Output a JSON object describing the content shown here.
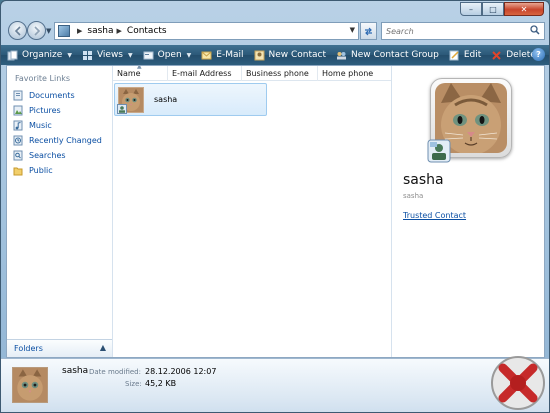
{
  "window": {
    "caption": {
      "min": "–",
      "max": "□",
      "close": "✕"
    }
  },
  "address_bar": {
    "crumbs": [
      "sasha",
      "Contacts"
    ],
    "search_placeholder": "Search"
  },
  "toolbar": {
    "items": [
      {
        "label": "Organize",
        "icon": "organize-icon",
        "dropdown": true
      },
      {
        "label": "Views",
        "icon": "views-icon",
        "dropdown": true
      },
      {
        "label": "Open",
        "icon": "open-icon",
        "dropdown": true
      },
      {
        "label": "E-Mail",
        "icon": "email-icon",
        "dropdown": false
      },
      {
        "label": "New Contact",
        "icon": "new-contact-icon",
        "dropdown": false
      },
      {
        "label": "New Contact Group",
        "icon": "new-contact-group-icon",
        "dropdown": false
      },
      {
        "label": "Edit",
        "icon": "edit-icon",
        "dropdown": false
      },
      {
        "label": "Delete",
        "icon": "delete-icon",
        "dropdown": false
      }
    ],
    "more": "»",
    "help": "?"
  },
  "nav_pane": {
    "title": "Favorite Links",
    "links": [
      {
        "label": "Documents",
        "icon": "documents-icon"
      },
      {
        "label": "Pictures",
        "icon": "pictures-icon"
      },
      {
        "label": "Music",
        "icon": "music-icon"
      },
      {
        "label": "Recently Changed",
        "icon": "recently-changed-icon"
      },
      {
        "label": "Searches",
        "icon": "searches-icon"
      },
      {
        "label": "Public",
        "icon": "public-folder-icon"
      }
    ],
    "folders_label": "Folders"
  },
  "file_list": {
    "columns": [
      "Name",
      "E-mail Address",
      "Business phone",
      "Home phone"
    ],
    "items": [
      {
        "name": "sasha",
        "selected": true
      }
    ]
  },
  "preview": {
    "name": "sasha",
    "subtitle": "sasha",
    "link": "Trusted Contact"
  },
  "details": {
    "name": "sasha",
    "modified_label": "Date modified:",
    "modified_value": "28.12.2006 12:07",
    "size_label": "Size:",
    "size_value": "45,2 KB"
  },
  "colors": {
    "toolbar": "#2b5878",
    "link": "#0b4fa3",
    "selection": "#d8ebfb"
  }
}
